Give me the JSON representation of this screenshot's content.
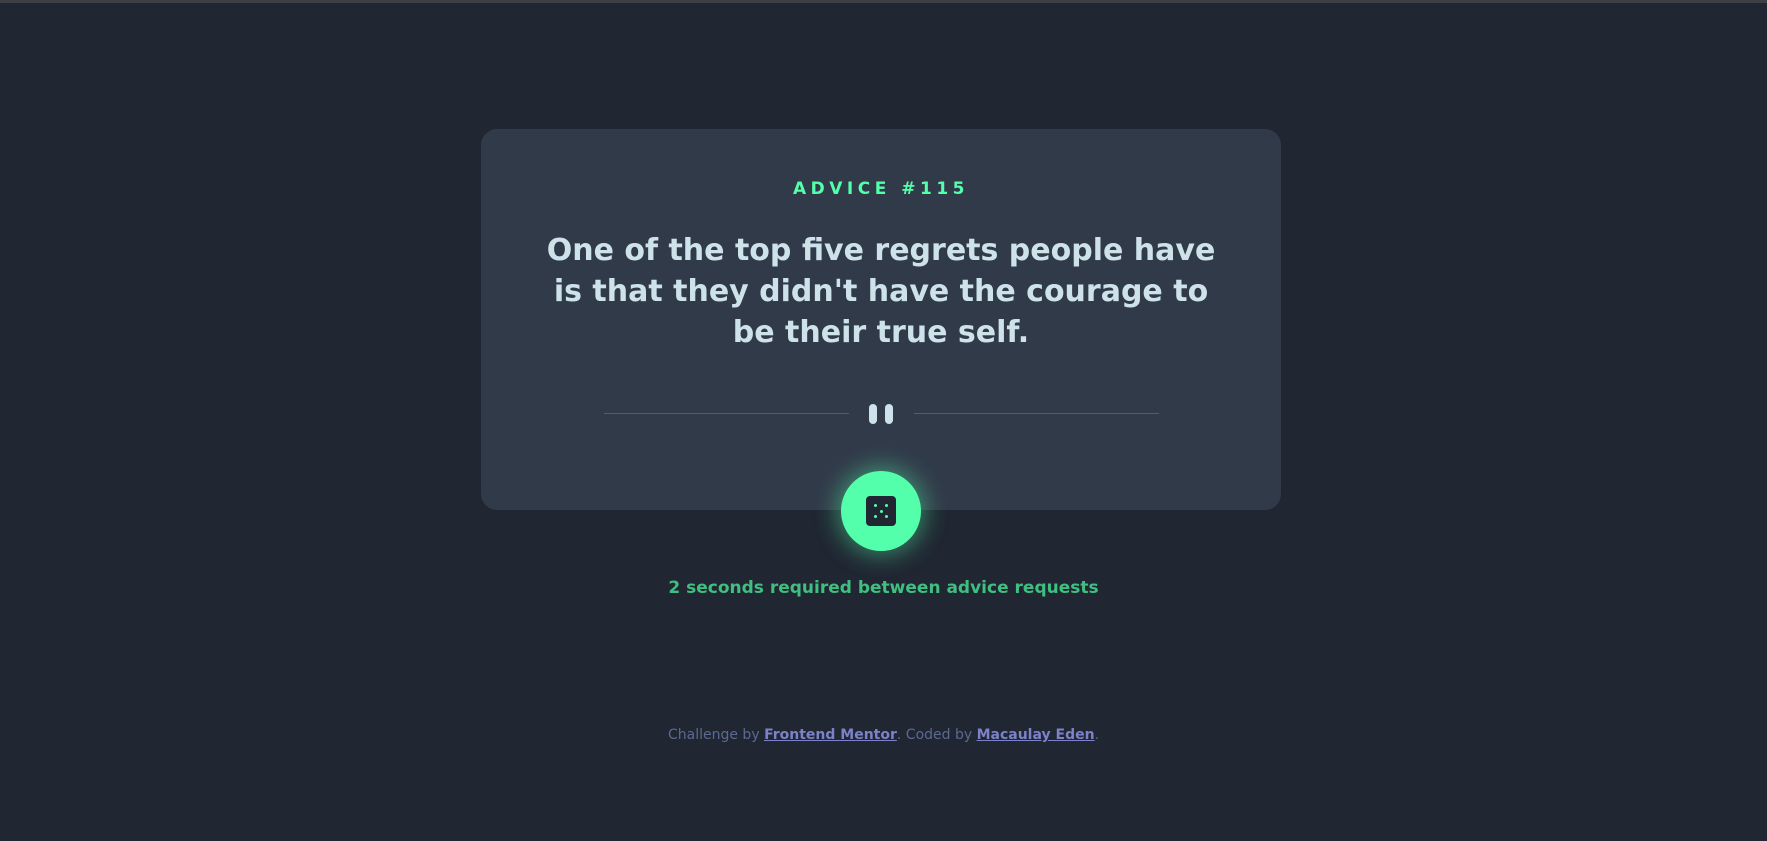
{
  "card": {
    "advice_id": "ADVICE #115",
    "advice_text": "One of the top five regrets people have is that they didn't have the courage to be their true self."
  },
  "divider": {
    "icon": "pause-icon"
  },
  "dice_button": {
    "icon": "dice-icon"
  },
  "status": {
    "message": "2 seconds required between advice requests"
  },
  "footer": {
    "prefix": "Challenge by ",
    "link1": "Frontend Mentor",
    "middle": ". Coded by ",
    "link2": "Macaulay Eden",
    "suffix": "."
  },
  "colors": {
    "background": "#202632",
    "card": "#313a49",
    "accent": "#53ffaa",
    "text": "#cee3e9",
    "footer_link": "#7b82c8"
  }
}
